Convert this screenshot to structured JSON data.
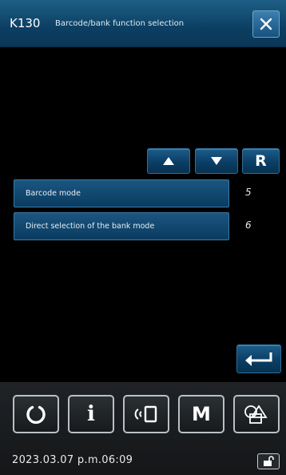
{
  "header": {
    "code": "K130",
    "title": "Barcode/bank function selection",
    "close_icon": "close-icon"
  },
  "nav": {
    "up_icon": "arrow-up-icon",
    "down_icon": "arrow-down-icon",
    "reset_label": "R"
  },
  "items": [
    {
      "label": "Barcode mode",
      "value": "5"
    },
    {
      "label": "Direct selection of the bank mode",
      "value": "6"
    }
  ],
  "enter_icon": "enter-return-icon",
  "toolbar": {
    "buttons": [
      {
        "icon": "refresh-icon"
      },
      {
        "icon": "info-icon",
        "label": "i"
      },
      {
        "icon": "nfc-communication-icon"
      },
      {
        "icon": "memory-icon",
        "label": "M"
      },
      {
        "icon": "shapes-icon"
      }
    ]
  },
  "status": {
    "datetime": "2023.03.07 p.m.06:09",
    "lock_icon": "unlock-icon"
  },
  "colors": {
    "accent": "#0b3e66",
    "button_border": "#2e6e99",
    "background": "#000000"
  }
}
